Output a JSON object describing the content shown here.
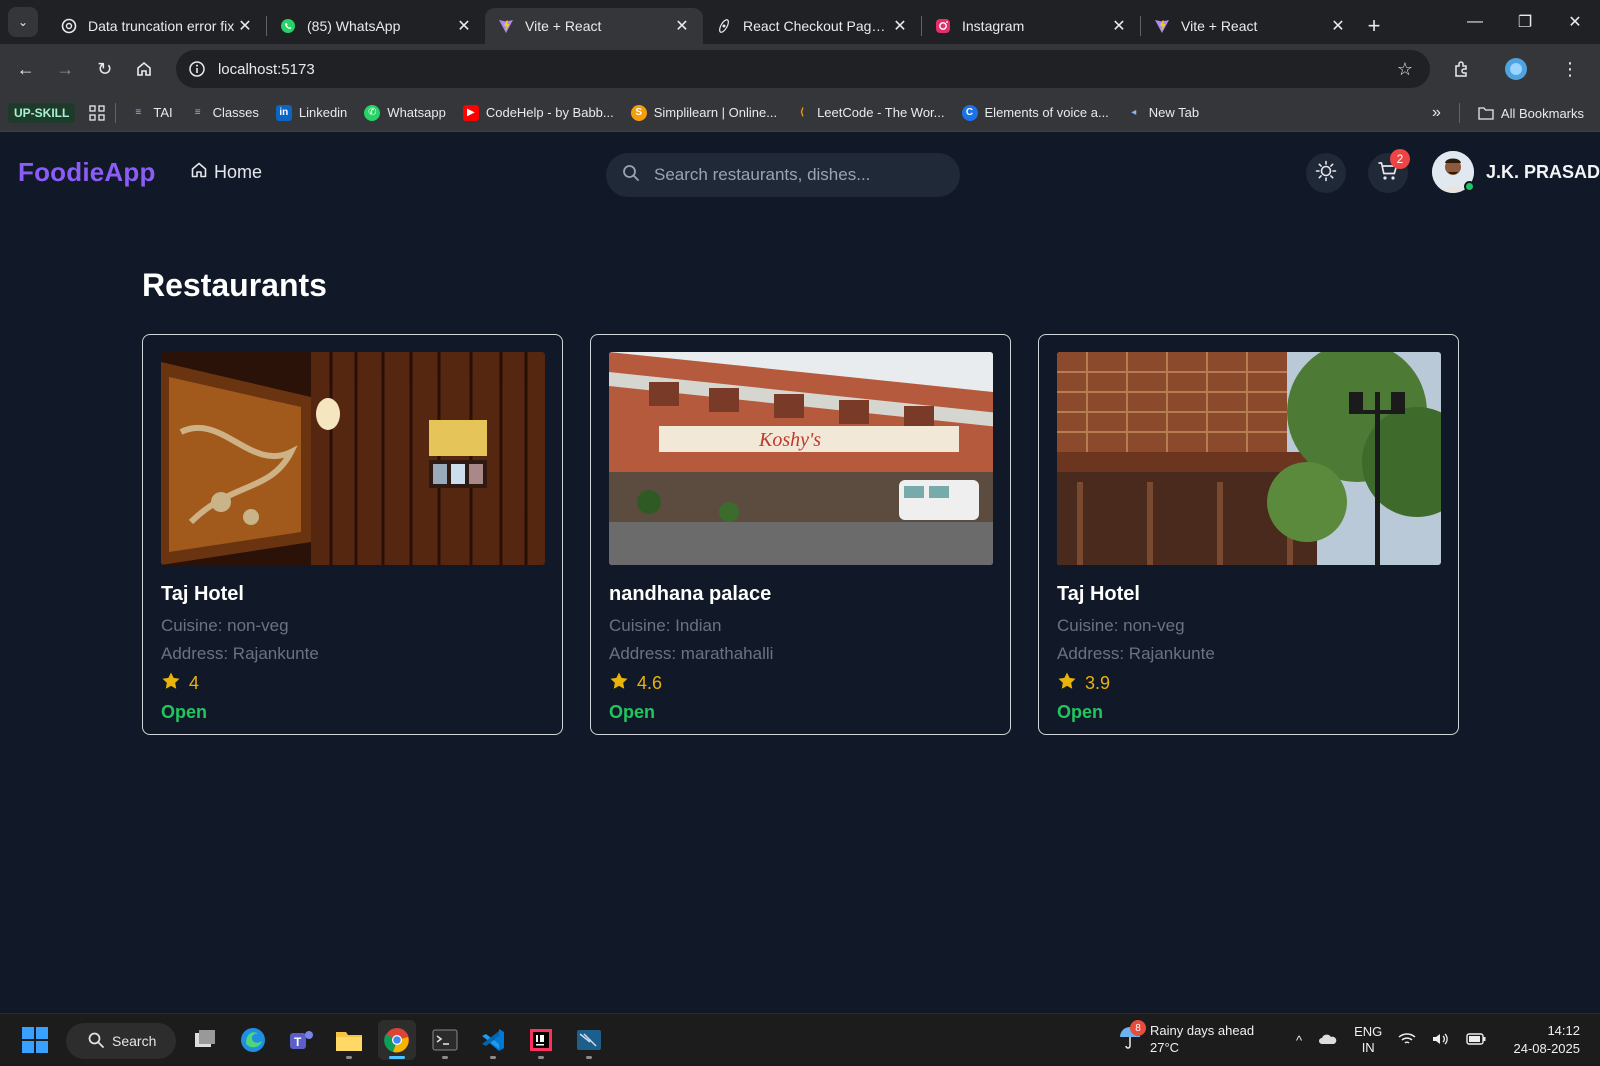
{
  "browser": {
    "tabs": [
      {
        "title": "Data truncation error fix",
        "icon": "chatgpt-icon",
        "active": false
      },
      {
        "title": "(85) WhatsApp",
        "icon": "whatsapp-icon",
        "active": false
      },
      {
        "title": "Vite + React",
        "icon": "vite-icon",
        "active": true
      },
      {
        "title": "React Checkout Page Im",
        "icon": "react-icon",
        "active": false
      },
      {
        "title": "Instagram",
        "icon": "instagram-icon",
        "active": false
      },
      {
        "title": "Vite + React",
        "icon": "vite-icon",
        "active": false
      }
    ],
    "url": "localhost:5173",
    "bookmarks": [
      {
        "label": "TAI",
        "icon": "folder-icon"
      },
      {
        "label": "Classes",
        "icon": "folder-icon"
      },
      {
        "label": "Linkedin",
        "icon": "linkedin-icon"
      },
      {
        "label": "Whatsapp",
        "icon": "whatsapp-icon"
      },
      {
        "label": "CodeHelp - by Babb...",
        "icon": "youtube-icon"
      },
      {
        "label": "Simplilearn | Online...",
        "icon": "simplilearn-icon"
      },
      {
        "label": "LeetCode - The Wor...",
        "icon": "leetcode-icon"
      },
      {
        "label": "Elements of voice a...",
        "icon": "c-icon"
      },
      {
        "label": "New Tab",
        "icon": "newtab-icon"
      }
    ],
    "upskill_label": "UP-SKILL",
    "all_bookmarks_label": "All Bookmarks"
  },
  "app": {
    "logo": "FoodieApp",
    "nav_home": "Home",
    "search_placeholder": "Search restaurants, dishes...",
    "cart_count": "2",
    "username": "J.K. PRASAD",
    "page_title": "Restaurants",
    "restaurants": [
      {
        "name": "Taj Hotel",
        "cuisine": "Cuisine: non-veg",
        "address": "Address: Rajankunte",
        "rating": "4",
        "status": "Open"
      },
      {
        "name": "nandhana palace",
        "cuisine": "Cuisine: Indian",
        "address": "Address: marathahalli",
        "rating": "4.6",
        "status": "Open"
      },
      {
        "name": "Taj Hotel",
        "cuisine": "Cuisine: non-veg",
        "address": "Address: Rajankunte",
        "rating": "3.9",
        "status": "Open"
      }
    ],
    "colors": {
      "accent": "#8b5cf6",
      "open": "#22c55e",
      "star": "#eab308",
      "bg": "#111827"
    }
  },
  "taskbar": {
    "search_label": "Search",
    "weather_title": "Rainy days ahead",
    "weather_temp": "27°C",
    "weather_badge": "8",
    "lang_top": "ENG",
    "lang_bottom": "IN",
    "time": "14:12",
    "date": "24-08-2025"
  }
}
